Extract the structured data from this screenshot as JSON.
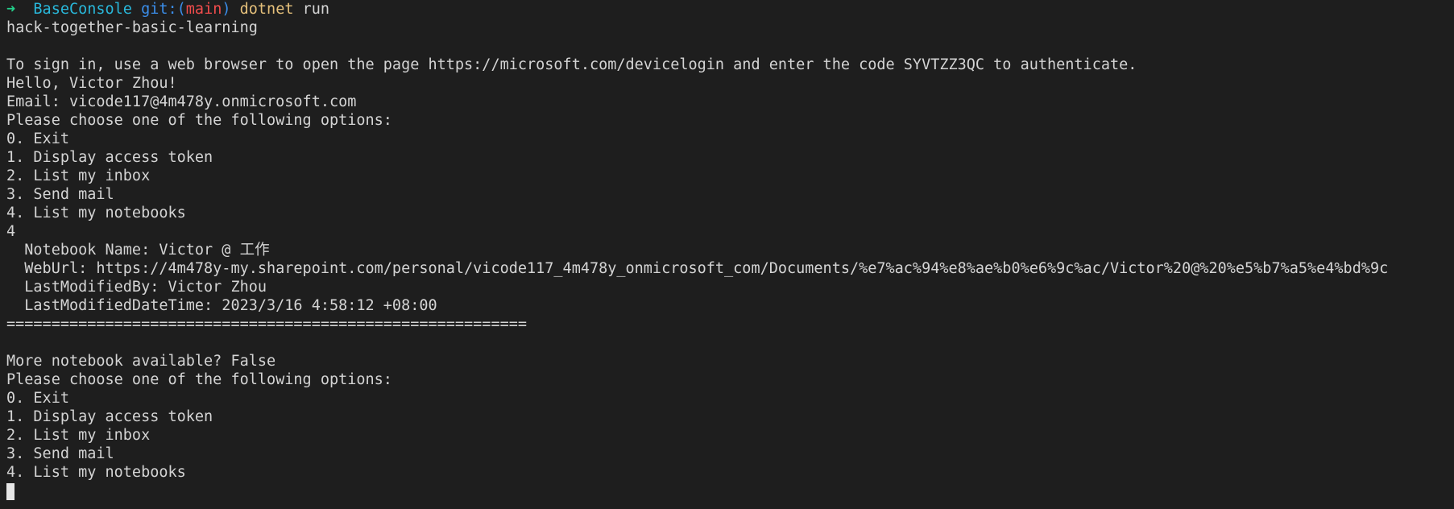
{
  "prompt": {
    "arrow": "➜",
    "directory": "BaseConsole",
    "git_label": "git:(",
    "branch": "main",
    "git_close": ")",
    "command": "dotnet",
    "args": "run"
  },
  "output": [
    "hack-together-basic-learning",
    "",
    "To sign in, use a web browser to open the page https://microsoft.com/devicelogin and enter the code SYVTZZ3QC to authenticate.",
    "Hello, Victor Zhou!",
    "Email: vicode117@4m478y.onmicrosoft.com",
    "Please choose one of the following options:",
    "0. Exit",
    "1. Display access token",
    "2. List my inbox",
    "3. Send mail",
    "4. List my notebooks",
    "4",
    "  Notebook Name: Victor @ 工作",
    "  WebUrl: https://4m478y-my.sharepoint.com/personal/vicode117_4m478y_onmicrosoft_com/Documents/%e7%ac%94%e8%ae%b0%e6%9c%ac/Victor%20@%20%e5%b7%a5%e4%bd%9c",
    "  LastModifiedBy: Victor Zhou",
    "  LastModifiedDateTime: 2023/3/16 4:58:12 +08:00",
    "==========================================================",
    "",
    "More notebook available? False",
    "Please choose one of the following options:",
    "0. Exit",
    "1. Display access token",
    "2. List my inbox",
    "3. Send mail",
    "4. List my notebooks"
  ]
}
